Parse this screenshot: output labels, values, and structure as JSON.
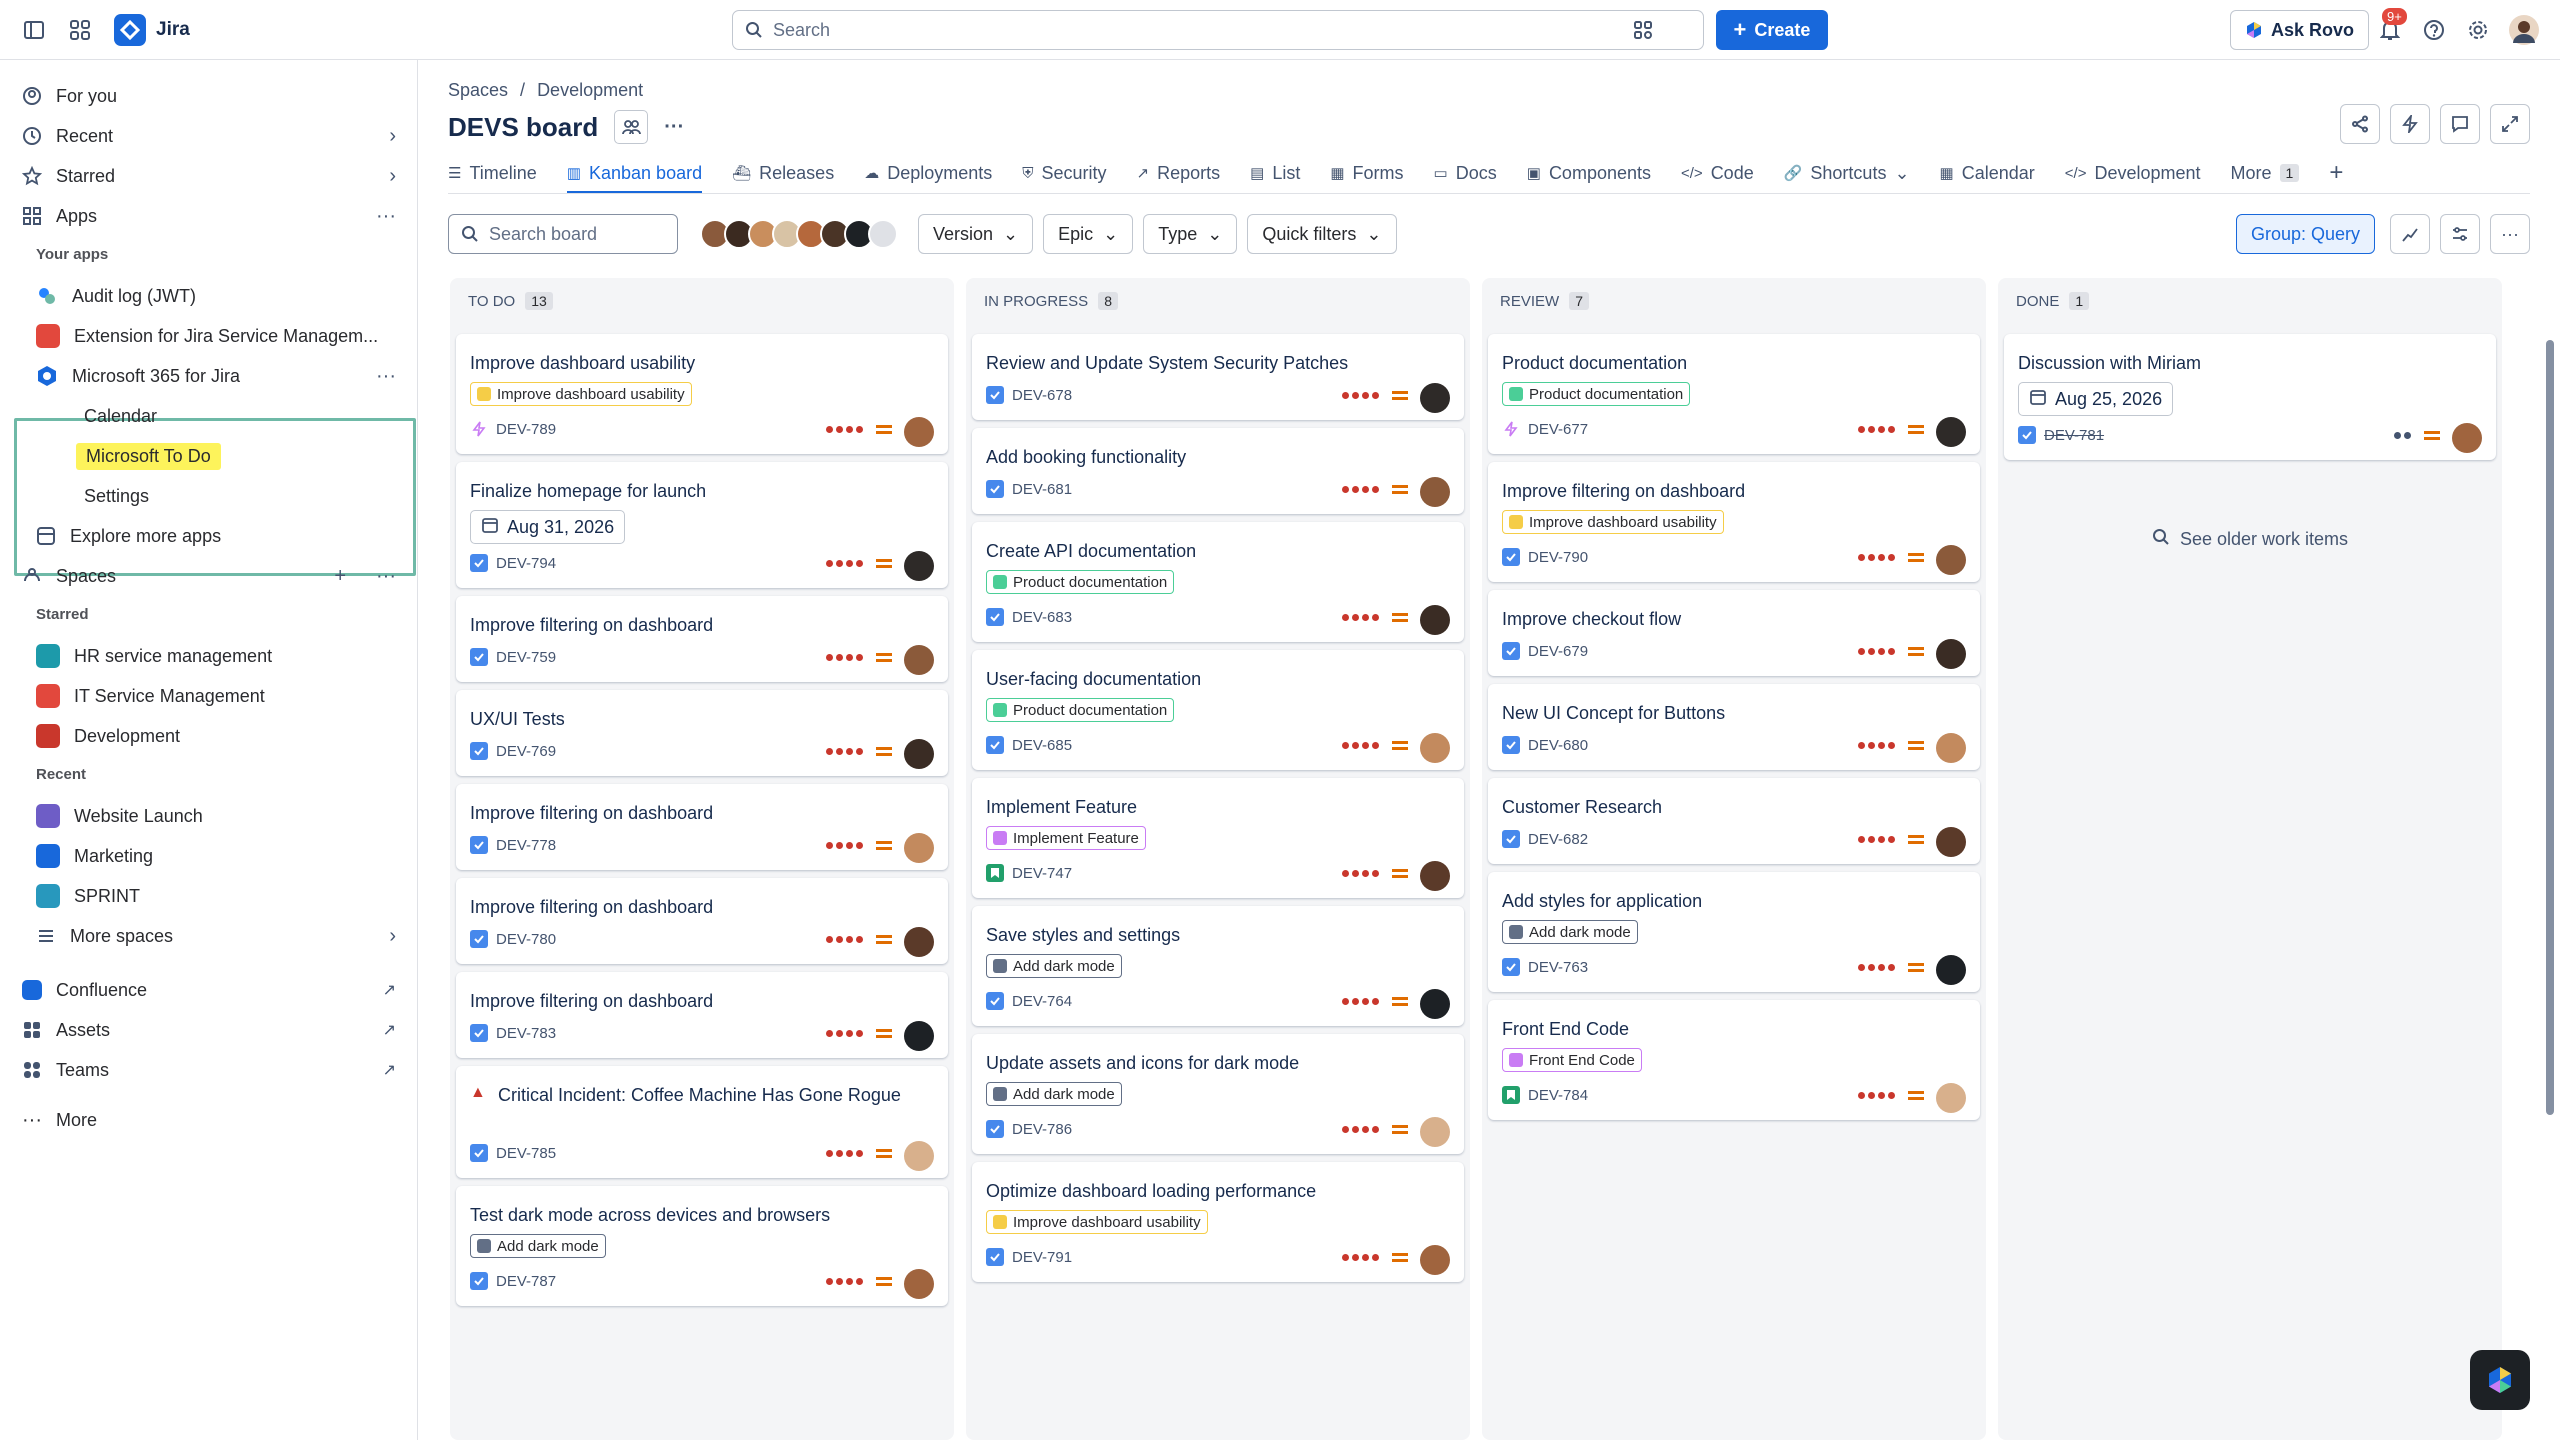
{
  "topbar": {
    "app_name": "Jira",
    "search_placeholder": "Search",
    "create_label": "Create",
    "ask_rovo_label": "Ask Rovo",
    "notifications_badge": "9+"
  },
  "sidebar": {
    "for_you": "For you",
    "recent": "Recent",
    "starred": "Starred",
    "apps": "Apps",
    "your_apps_heading": "Your apps",
    "app_items": [
      "Audit log (JWT)",
      "Extension for Jira Service Managem...",
      "Microsoft 365 for Jira"
    ],
    "ms365_subitems": [
      "Calendar",
      "Microsoft To Do",
      "Settings"
    ],
    "explore_more_apps": "Explore more apps",
    "spaces": "Spaces",
    "starred_heading": "Starred",
    "starred_spaces": [
      "HR service management",
      "IT Service Management",
      "Development"
    ],
    "recent_heading": "Recent",
    "recent_spaces": [
      "Website Launch",
      "Marketing",
      "SPRINT"
    ],
    "more_spaces": "More spaces",
    "confluence": "Confluence",
    "assets": "Assets",
    "teams": "Teams",
    "more": "More"
  },
  "header": {
    "breadcrumb": [
      "Spaces",
      "Development"
    ],
    "breadcrumb_sep": "/",
    "title": "DEVS board"
  },
  "tabs": [
    "Timeline",
    "Kanban board",
    "Releases",
    "Deployments",
    "Security",
    "Reports",
    "List",
    "Forms",
    "Docs",
    "Components",
    "Code",
    "Shortcuts",
    "Calendar",
    "Development",
    "More"
  ],
  "tab_more_count": "1",
  "active_tab": "Kanban board",
  "filters": {
    "search_placeholder": "Search board",
    "version": "Version",
    "epic": "Epic",
    "type": "Type",
    "quick_filters": "Quick filters",
    "group": "Group: Query"
  },
  "columns": [
    {
      "name": "TO DO",
      "count": "13",
      "cards": [
        {
          "title": "Improve dashboard usability",
          "epic": "Improve dashboard usability",
          "epic_color": "#f5cd47",
          "key": "DEV-789",
          "type": "epic"
        },
        {
          "title": "Finalize homepage for launch",
          "date": "Aug 31, 2026",
          "key": "DEV-794",
          "type": "task"
        },
        {
          "title": "Improve filtering on dashboard",
          "key": "DEV-759",
          "type": "task"
        },
        {
          "title": "UX/UI Tests",
          "key": "DEV-769",
          "type": "task"
        },
        {
          "title": "Improve filtering on dashboard",
          "key": "DEV-778",
          "type": "task"
        },
        {
          "title": "Improve filtering on dashboard",
          "key": "DEV-780",
          "type": "task"
        },
        {
          "title": "Improve filtering on dashboard",
          "key": "DEV-783",
          "type": "task"
        },
        {
          "title": "Critical Incident: Coffee Machine Has Gone Rogue",
          "key": "DEV-785",
          "type": "task"
        },
        {
          "title": "Test dark mode across devices and browsers",
          "epic": "Add dark mode",
          "epic_color": "#626f86",
          "key": "DEV-787",
          "type": "task"
        }
      ]
    },
    {
      "name": "IN PROGRESS",
      "count": "8",
      "cards": [
        {
          "title": "Review and Update System Security Patches",
          "key": "DEV-678",
          "type": "task"
        },
        {
          "title": "Add booking functionality",
          "key": "DEV-681",
          "type": "task"
        },
        {
          "title": "Create API documentation",
          "epic": "Product documentation",
          "epic_color": "#4bce97",
          "key": "DEV-683",
          "type": "task"
        },
        {
          "title": "User-facing documentation",
          "epic": "Product documentation",
          "epic_color": "#4bce97",
          "key": "DEV-685",
          "type": "task"
        },
        {
          "title": "Implement Feature",
          "epic": "Implement Feature",
          "epic_color": "#c97cf4",
          "key": "DEV-747",
          "type": "story"
        },
        {
          "title": "Save styles and settings",
          "epic": "Add dark mode",
          "epic_color": "#626f86",
          "key": "DEV-764",
          "type": "task"
        },
        {
          "title": "Update assets and icons for dark mode",
          "epic": "Add dark mode",
          "epic_color": "#626f86",
          "key": "DEV-786",
          "type": "task"
        },
        {
          "title": "Optimize dashboard loading performance",
          "epic": "Improve dashboard usability",
          "epic_color": "#f5cd47",
          "key": "DEV-791",
          "type": "task"
        }
      ]
    },
    {
      "name": "REVIEW",
      "count": "7",
      "cards": [
        {
          "title": "Product documentation",
          "epic": "Product documentation",
          "epic_color": "#4bce97",
          "key": "DEV-677",
          "type": "epic"
        },
        {
          "title": "Improve filtering on dashboard",
          "epic": "Improve dashboard usability",
          "epic_color": "#f5cd47",
          "key": "DEV-790",
          "type": "task"
        },
        {
          "title": "Improve checkout flow",
          "key": "DEV-679",
          "type": "task"
        },
        {
          "title": "New UI Concept for Buttons",
          "key": "DEV-680",
          "type": "task"
        },
        {
          "title": "Customer Research",
          "key": "DEV-682",
          "type": "task"
        },
        {
          "title": "Add styles for application",
          "epic": "Add dark mode",
          "epic_color": "#626f86",
          "key": "DEV-763",
          "type": "task"
        },
        {
          "title": "Front End Code",
          "epic": "Front End Code",
          "epic_color": "#c97cf4",
          "key": "DEV-784",
          "type": "story"
        }
      ]
    },
    {
      "name": "DONE",
      "count": "1",
      "cards": [
        {
          "title": "Discussion with Miriam",
          "date": "Aug 25, 2026",
          "key": "DEV-781",
          "type": "task"
        }
      ],
      "see_older": "See older work items"
    }
  ],
  "colors": {
    "brand": "#1868db",
    "priority_dot": "#c9372c",
    "priority_medium": "#e06c00",
    "sidebar_highlight_border": "#6fb9a7",
    "todo_highlight": "#fdf35b"
  }
}
